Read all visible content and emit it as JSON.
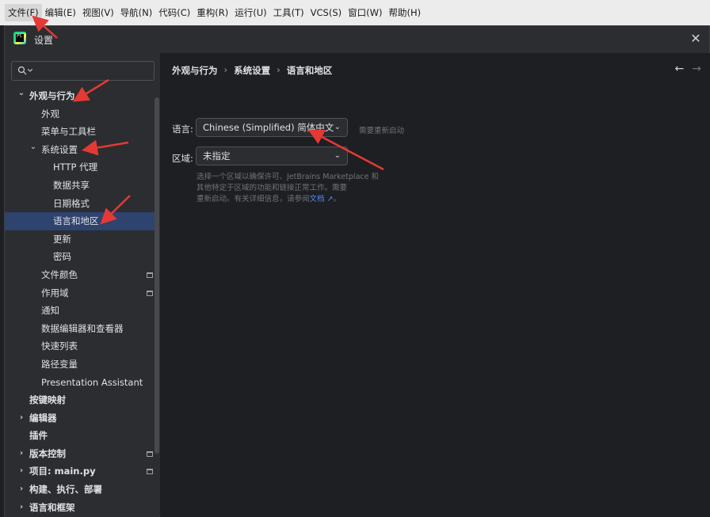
{
  "menubar": {
    "items": [
      "文件(F)",
      "编辑(E)",
      "视图(V)",
      "导航(N)",
      "代码(C)",
      "重构(R)",
      "运行(U)",
      "工具(T)",
      "VCS(S)",
      "窗口(W)",
      "帮助(H)"
    ]
  },
  "dialog": {
    "title": "设置",
    "close_icon": "✕"
  },
  "sidebar": {
    "search_placeholder": "",
    "tree": [
      {
        "label": "外观与行为",
        "indent": 1,
        "chevron": "expanded",
        "bold": true
      },
      {
        "label": "外观",
        "indent": 2
      },
      {
        "label": "菜单与工具栏",
        "indent": 2
      },
      {
        "label": "系统设置",
        "indent": 2,
        "chevron": "expanded"
      },
      {
        "label": "HTTP 代理",
        "indent": 3
      },
      {
        "label": "数据共享",
        "indent": 3
      },
      {
        "label": "日期格式",
        "indent": 3
      },
      {
        "label": "语言和地区",
        "indent": 3,
        "selected": true
      },
      {
        "label": "更新",
        "indent": 3
      },
      {
        "label": "密码",
        "indent": 3
      },
      {
        "label": "文件颜色",
        "indent": 2,
        "badge": true
      },
      {
        "label": "作用域",
        "indent": 2,
        "badge": true
      },
      {
        "label": "通知",
        "indent": 2
      },
      {
        "label": "数据编辑器和查看器",
        "indent": 2
      },
      {
        "label": "快速列表",
        "indent": 2
      },
      {
        "label": "路径变量",
        "indent": 2
      },
      {
        "label": "Presentation Assistant",
        "indent": 2
      },
      {
        "label": "按键映射",
        "indent": 1,
        "bold": true
      },
      {
        "label": "编辑器",
        "indent": 1,
        "chevron": "collapsed",
        "bold": true
      },
      {
        "label": "插件",
        "indent": 1,
        "bold": true
      },
      {
        "label": "版本控制",
        "indent": 1,
        "chevron": "collapsed",
        "bold": true,
        "badge": true
      },
      {
        "label": "项目: main.py",
        "indent": 1,
        "chevron": "collapsed",
        "bold": true,
        "badge": true
      },
      {
        "label": "构建、执行、部署",
        "indent": 1,
        "chevron": "collapsed",
        "bold": true
      },
      {
        "label": "语言和框架",
        "indent": 1,
        "chevron": "collapsed",
        "bold": true
      }
    ]
  },
  "main": {
    "breadcrumb": [
      "外观与行为",
      "系统设置",
      "语言和地区"
    ],
    "language": {
      "label": "语言:",
      "value": "Chinese (Simplified) 简体中文",
      "hint": "需要重新启动"
    },
    "region": {
      "label": "区域:",
      "value": "未指定"
    },
    "description_line1": "选择一个区域以确保许可、JetBrains Marketplace 和",
    "description_line2": "其他特定于区域的功能和链接正常工作。需要",
    "description_line3": "重新启动。有关详细信息，请参阅",
    "description_link": "文档 ↗",
    "description_end": "。"
  },
  "colors": {
    "accent_selection": "#2e436e",
    "link": "#548af7",
    "annotation": "#e53935"
  }
}
